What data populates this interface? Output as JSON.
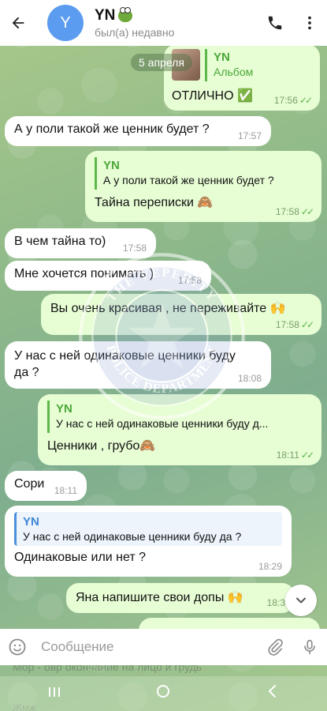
{
  "header": {
    "avatar_letter": "Y",
    "title": "YN",
    "status": "был(а) недавно"
  },
  "date_pill": "5 апреля",
  "messages": [
    {
      "reply_name": "YN",
      "reply_text": "Альбом",
      "text": "ОТЛИЧНО ✅",
      "time": "17:56"
    },
    {
      "text": "А у поли такой же ценник будет ?",
      "time": "17:57"
    },
    {
      "reply_name": "YN",
      "reply_text": "А у поли такой же ценник будет ?",
      "text": "Тайна переписки 🙈",
      "time": "17:58"
    },
    {
      "text": "В чем тайна то)",
      "time": "17:58"
    },
    {
      "text": "Мне хочется понимать )",
      "time": "17:58"
    },
    {
      "text": "Вы очень красивая , не переживайте 🙌",
      "time": "17:58"
    },
    {
      "text": "У нас с ней одинаковые ценники буду да ?",
      "time": "18:08"
    },
    {
      "reply_name": "YN",
      "reply_text": "У нас с ней одинаковые ценники буду д...",
      "text": "Ценники , грубо🙈",
      "time": "18:11"
    },
    {
      "text": "Сори",
      "time": "18:11"
    },
    {
      "reply_name": "YN",
      "reply_text": "У нас с ней одинаковые ценники буду да ?",
      "text": "Одинаковые или нет ?",
      "time": "18:29"
    },
    {
      "text": "Яна напишите свои допы 🙌",
      "time": "18:3"
    }
  ],
  "watermark": "THE VEPERITY · POLICE DEPARTMENT",
  "composer": {
    "placeholder": "Сообщение"
  },
  "under_text": "Мбр - овр окончание на лицо и грудь",
  "under_text2": "Жмж",
  "colors": {
    "incoming_bubble": "#ffffff",
    "outgoing_bubble": "#e7fdd4",
    "accent_green": "#4aa838",
    "accent_blue": "#5b9bf0"
  },
  "icons": [
    "back-arrow-icon",
    "phone-icon",
    "more-vert-icon",
    "emoji-icon",
    "attach-icon",
    "mic-icon",
    "chevron-down-icon"
  ]
}
